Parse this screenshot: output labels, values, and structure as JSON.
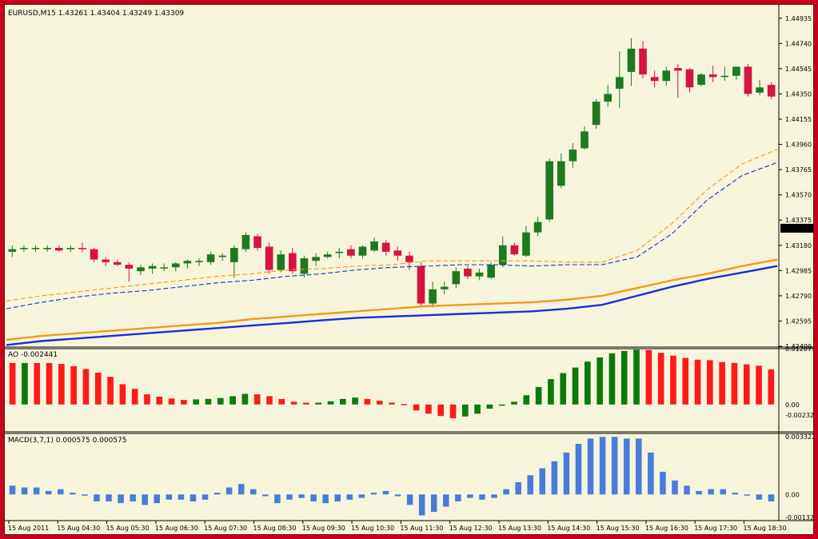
{
  "colors": {
    "background": "#f6f5dc",
    "frame": "#c4001a",
    "bull": "#1f7a1f",
    "bear": "#d8143c",
    "ao_up": "#0b7a0b",
    "ao_down": "#ff1a1a",
    "macd": "#4a7bdc",
    "ma_orange": "#f29a1a",
    "ma_blue": "#1a2fd8"
  },
  "chart_data": [
    {
      "type": "candlestick",
      "title": "EURUSD,M15  1.43261 1.43404 1.43249 1.43309",
      "ylim": [
        1.424,
        1.4502
      ],
      "yticks": [
        "1.44935",
        "1.44740",
        "1.44545",
        "1.44350",
        "1.44155",
        "1.43960",
        "1.43765",
        "1.43570",
        "1.43375",
        "1.43180",
        "1.42985",
        "1.42790",
        "1.42595",
        "1.42400"
      ],
      "current_price": "1.43309",
      "x": [
        "15 Aug 2011",
        "15 Aug 04:30",
        "15 Aug 05:30",
        "15 Aug 06:30",
        "15 Aug 07:30",
        "15 Aug 08:30",
        "15 Aug 09:30",
        "15 Aug 10:30",
        "15 Aug 11:30",
        "15 Aug 12:30",
        "15 Aug 13:30",
        "15 Aug 14:30",
        "15 Aug 15:30",
        "15 Aug 16:30",
        "15 Aug 17:30",
        "15 Aug 18:30"
      ],
      "candles": [
        {
          "o": 1.4313,
          "h": 1.4318,
          "l": 1.4309,
          "c": 1.4315
        },
        {
          "o": 1.4315,
          "h": 1.4318,
          "l": 1.4313,
          "c": 1.4316
        },
        {
          "o": 1.4315,
          "h": 1.4318,
          "l": 1.4313,
          "c": 1.4316
        },
        {
          "o": 1.4315,
          "h": 1.4318,
          "l": 1.4313,
          "c": 1.4316
        },
        {
          "o": 1.4316,
          "h": 1.4318,
          "l": 1.4313,
          "c": 1.4314
        },
        {
          "o": 1.4315,
          "h": 1.4318,
          "l": 1.4313,
          "c": 1.4316
        },
        {
          "o": 1.4316,
          "h": 1.432,
          "l": 1.4313,
          "c": 1.4315
        },
        {
          "o": 1.4315,
          "h": 1.4316,
          "l": 1.4305,
          "c": 1.4307
        },
        {
          "o": 1.4307,
          "h": 1.4309,
          "l": 1.4302,
          "c": 1.4305
        },
        {
          "o": 1.4305,
          "h": 1.4307,
          "l": 1.4302,
          "c": 1.4303
        },
        {
          "o": 1.4303,
          "h": 1.4305,
          "l": 1.429,
          "c": 1.43
        },
        {
          "o": 1.4298,
          "h": 1.4303,
          "l": 1.4295,
          "c": 1.4301
        },
        {
          "o": 1.43,
          "h": 1.4304,
          "l": 1.4296,
          "c": 1.4302
        },
        {
          "o": 1.4301,
          "h": 1.4304,
          "l": 1.4298,
          "c": 1.4301
        },
        {
          "o": 1.4301,
          "h": 1.4305,
          "l": 1.4298,
          "c": 1.4304
        },
        {
          "o": 1.4304,
          "h": 1.4307,
          "l": 1.43,
          "c": 1.4306
        },
        {
          "o": 1.4305,
          "h": 1.4308,
          "l": 1.4302,
          "c": 1.4306
        },
        {
          "o": 1.4305,
          "h": 1.4313,
          "l": 1.4303,
          "c": 1.4311
        },
        {
          "o": 1.4309,
          "h": 1.4312,
          "l": 1.4306,
          "c": 1.431
        },
        {
          "o": 1.4305,
          "h": 1.4318,
          "l": 1.4293,
          "c": 1.4316
        },
        {
          "o": 1.4315,
          "h": 1.4328,
          "l": 1.4313,
          "c": 1.4326
        },
        {
          "o": 1.4325,
          "h": 1.4327,
          "l": 1.4314,
          "c": 1.4316
        },
        {
          "o": 1.4317,
          "h": 1.432,
          "l": 1.4296,
          "c": 1.4299
        },
        {
          "o": 1.4299,
          "h": 1.4314,
          "l": 1.4297,
          "c": 1.4311
        },
        {
          "o": 1.4312,
          "h": 1.4316,
          "l": 1.4296,
          "c": 1.4298
        },
        {
          "o": 1.4296,
          "h": 1.431,
          "l": 1.4293,
          "c": 1.4308
        },
        {
          "o": 1.4306,
          "h": 1.4312,
          "l": 1.4302,
          "c": 1.4309
        },
        {
          "o": 1.4309,
          "h": 1.4313,
          "l": 1.4308,
          "c": 1.4311
        },
        {
          "o": 1.4312,
          "h": 1.4316,
          "l": 1.4308,
          "c": 1.4313
        },
        {
          "o": 1.4315,
          "h": 1.4318,
          "l": 1.4308,
          "c": 1.431
        },
        {
          "o": 1.431,
          "h": 1.4318,
          "l": 1.4308,
          "c": 1.4317
        },
        {
          "o": 1.4314,
          "h": 1.4324,
          "l": 1.4313,
          "c": 1.4321
        },
        {
          "o": 1.432,
          "h": 1.4322,
          "l": 1.431,
          "c": 1.4313
        },
        {
          "o": 1.4314,
          "h": 1.4317,
          "l": 1.4306,
          "c": 1.431
        },
        {
          "o": 1.431,
          "h": 1.4313,
          "l": 1.4299,
          "c": 1.4305
        },
        {
          "o": 1.4302,
          "h": 1.4305,
          "l": 1.427,
          "c": 1.4273
        },
        {
          "o": 1.4273,
          "h": 1.429,
          "l": 1.427,
          "c": 1.4284
        },
        {
          "o": 1.4284,
          "h": 1.429,
          "l": 1.428,
          "c": 1.4286
        },
        {
          "o": 1.4288,
          "h": 1.4301,
          "l": 1.4285,
          "c": 1.4298
        },
        {
          "o": 1.43,
          "h": 1.4302,
          "l": 1.4292,
          "c": 1.4294
        },
        {
          "o": 1.4294,
          "h": 1.43,
          "l": 1.4291,
          "c": 1.4297
        },
        {
          "o": 1.4293,
          "h": 1.4305,
          "l": 1.4292,
          "c": 1.4303
        },
        {
          "o": 1.4303,
          "h": 1.4325,
          "l": 1.4301,
          "c": 1.4318
        },
        {
          "o": 1.4318,
          "h": 1.432,
          "l": 1.431,
          "c": 1.4311
        },
        {
          "o": 1.431,
          "h": 1.4333,
          "l": 1.4309,
          "c": 1.4328
        },
        {
          "o": 1.4328,
          "h": 1.434,
          "l": 1.4325,
          "c": 1.4336
        },
        {
          "o": 1.4338,
          "h": 1.4385,
          "l": 1.4336,
          "c": 1.4383
        },
        {
          "o": 1.4364,
          "h": 1.4389,
          "l": 1.4362,
          "c": 1.4383
        },
        {
          "o": 1.4383,
          "h": 1.4397,
          "l": 1.4378,
          "c": 1.4392
        },
        {
          "o": 1.4393,
          "h": 1.441,
          "l": 1.4392,
          "c": 1.4406
        },
        {
          "o": 1.4411,
          "h": 1.4431,
          "l": 1.4408,
          "c": 1.4429
        },
        {
          "o": 1.4429,
          "h": 1.4442,
          "l": 1.4425,
          "c": 1.4435
        },
        {
          "o": 1.4439,
          "h": 1.4468,
          "l": 1.4424,
          "c": 1.4448
        },
        {
          "o": 1.4452,
          "h": 1.4478,
          "l": 1.4441,
          "c": 1.447
        },
        {
          "o": 1.447,
          "h": 1.4476,
          "l": 1.4447,
          "c": 1.445
        },
        {
          "o": 1.4448,
          "h": 1.4453,
          "l": 1.444,
          "c": 1.4445
        },
        {
          "o": 1.4445,
          "h": 1.4456,
          "l": 1.4441,
          "c": 1.4453
        },
        {
          "o": 1.4455,
          "h": 1.4458,
          "l": 1.4432,
          "c": 1.4453
        },
        {
          "o": 1.4454,
          "h": 1.4455,
          "l": 1.4436,
          "c": 1.444
        },
        {
          "o": 1.4442,
          "h": 1.4451,
          "l": 1.4441,
          "c": 1.445
        },
        {
          "o": 1.445,
          "h": 1.4457,
          "l": 1.4444,
          "c": 1.4448
        },
        {
          "o": 1.4448,
          "h": 1.4456,
          "l": 1.4445,
          "c": 1.4449
        },
        {
          "o": 1.4449,
          "h": 1.4455,
          "l": 1.4446,
          "c": 1.4456
        },
        {
          "o": 1.4456,
          "h": 1.4458,
          "l": 1.4433,
          "c": 1.4435
        },
        {
          "o": 1.4436,
          "h": 1.4446,
          "l": 1.4434,
          "c": 1.444
        },
        {
          "o": 1.4442,
          "h": 1.4444,
          "l": 1.4431,
          "c": 1.4433
        }
      ],
      "moving_averages": [
        {
          "style": "dashed",
          "color": "ma_orange",
          "values": [
            1.4275,
            1.4279,
            1.4282,
            1.4285,
            1.4288,
            1.4291,
            1.4294,
            1.4296,
            1.4299,
            1.43,
            1.4302,
            1.4303,
            1.4306,
            1.4306,
            1.4306,
            1.4306,
            1.4305,
            1.4305,
            1.4314,
            1.4335,
            1.4361,
            1.4381,
            1.4392
          ]
        },
        {
          "style": "dashed",
          "color": "ma_blue",
          "values": [
            1.4269,
            1.4274,
            1.4278,
            1.4281,
            1.4283,
            1.4286,
            1.4289,
            1.4291,
            1.4294,
            1.4296,
            1.4299,
            1.4301,
            1.4302,
            1.4303,
            1.4303,
            1.4302,
            1.4303,
            1.4303,
            1.4309,
            1.4327,
            1.4353,
            1.4372,
            1.4382
          ]
        },
        {
          "style": "solid",
          "color": "ma_orange",
          "values": [
            1.4245,
            1.4248,
            1.425,
            1.4252,
            1.4254,
            1.4256,
            1.4258,
            1.4261,
            1.4263,
            1.4265,
            1.4267,
            1.4269,
            1.4271,
            1.4272,
            1.4273,
            1.4274,
            1.4276,
            1.4279,
            1.4285,
            1.4291,
            1.4296,
            1.4302,
            1.4307
          ]
        },
        {
          "style": "solid",
          "color": "ma_blue",
          "values": [
            1.4241,
            1.4244,
            1.4246,
            1.4248,
            1.425,
            1.4252,
            1.4254,
            1.4256,
            1.4258,
            1.426,
            1.4262,
            1.4263,
            1.4264,
            1.4265,
            1.4266,
            1.4267,
            1.4269,
            1.4272,
            1.4279,
            1.4286,
            1.4292,
            1.4297,
            1.4302
          ]
        }
      ]
    },
    {
      "type": "bar",
      "title": "AO -0.002441",
      "ylim": [
        -0.0035,
        0.0121
      ],
      "yticks": [
        "0.012079",
        "0.00",
        "-0.00232"
      ],
      "bars": [
        {
          "v": 0.009,
          "d": 0
        },
        {
          "v": 0.009,
          "d": 1
        },
        {
          "v": 0.009,
          "d": 0
        },
        {
          "v": 0.009,
          "d": 0
        },
        {
          "v": 0.0088,
          "d": 0
        },
        {
          "v": 0.0083,
          "d": 0
        },
        {
          "v": 0.0077,
          "d": 0
        },
        {
          "v": 0.0069,
          "d": 0
        },
        {
          "v": 0.006,
          "d": 0
        },
        {
          "v": 0.0044,
          "d": 0
        },
        {
          "v": 0.0034,
          "d": 0
        },
        {
          "v": 0.0022,
          "d": 0
        },
        {
          "v": 0.0017,
          "d": 0
        },
        {
          "v": 0.0013,
          "d": 0
        },
        {
          "v": 0.001,
          "d": 0
        },
        {
          "v": 0.0011,
          "d": 1
        },
        {
          "v": 0.0012,
          "d": 1
        },
        {
          "v": 0.0014,
          "d": 1
        },
        {
          "v": 0.0018,
          "d": 1
        },
        {
          "v": 0.0023,
          "d": 1
        },
        {
          "v": 0.0022,
          "d": 0
        },
        {
          "v": 0.0018,
          "d": 0
        },
        {
          "v": 0.0012,
          "d": 0
        },
        {
          "v": 0.0006,
          "d": 0
        },
        {
          "v": 0.0004,
          "d": 0
        },
        {
          "v": 0.0004,
          "d": 1
        },
        {
          "v": 0.0007,
          "d": 1
        },
        {
          "v": 0.0012,
          "d": 1
        },
        {
          "v": 0.0015,
          "d": 1
        },
        {
          "v": 0.0012,
          "d": 0
        },
        {
          "v": 0.0008,
          "d": 0
        },
        {
          "v": 0.0004,
          "d": 0
        },
        {
          "v": 0.0001,
          "d": 0
        },
        {
          "v": -0.0013,
          "d": 0
        },
        {
          "v": -0.002,
          "d": 0
        },
        {
          "v": -0.0025,
          "d": 0
        },
        {
          "v": -0.003,
          "d": 0
        },
        {
          "v": -0.0026,
          "d": 1
        },
        {
          "v": -0.002,
          "d": 1
        },
        {
          "v": -0.0009,
          "d": 1
        },
        {
          "v": -0.0002,
          "d": 1
        },
        {
          "v": 0.0006,
          "d": 1
        },
        {
          "v": 0.002,
          "d": 1
        },
        {
          "v": 0.0038,
          "d": 1
        },
        {
          "v": 0.0055,
          "d": 1
        },
        {
          "v": 0.0068,
          "d": 1
        },
        {
          "v": 0.008,
          "d": 1
        },
        {
          "v": 0.0093,
          "d": 1
        },
        {
          "v": 0.0102,
          "d": 1
        },
        {
          "v": 0.0111,
          "d": 1
        },
        {
          "v": 0.0116,
          "d": 1
        },
        {
          "v": 0.0119,
          "d": 1
        },
        {
          "v": 0.0118,
          "d": 0
        },
        {
          "v": 0.0112,
          "d": 0
        },
        {
          "v": 0.0106,
          "d": 0
        },
        {
          "v": 0.0101,
          "d": 0
        },
        {
          "v": 0.0097,
          "d": 0
        },
        {
          "v": 0.0096,
          "d": 0
        },
        {
          "v": 0.0092,
          "d": 0
        },
        {
          "v": 0.009,
          "d": 0
        },
        {
          "v": 0.0087,
          "d": 0
        },
        {
          "v": 0.0084,
          "d": 0
        },
        {
          "v": 0.0076,
          "d": 0
        }
      ]
    },
    {
      "type": "bar",
      "title": "MACD(3,7,1) 0.000575 0.000575",
      "ylim": [
        -0.0015,
        0.00345
      ],
      "yticks": [
        "0.003322",
        "0.00",
        "-0.00132"
      ],
      "values": [
        0.0005,
        0.0004,
        0.0004,
        0.0002,
        0.0003,
        0.0001,
        0.0,
        -0.0004,
        -0.0004,
        -0.0005,
        -0.0004,
        -0.0006,
        -0.0005,
        -0.0003,
        -0.0003,
        -0.0004,
        -0.0003,
        0.0001,
        0.0004,
        0.0006,
        0.0003,
        -0.0001,
        -0.0005,
        -0.0003,
        -0.0002,
        -0.0004,
        -0.0005,
        -0.0004,
        -0.0003,
        -0.0002,
        0.0001,
        0.0002,
        -0.0001,
        -0.0006,
        -0.0012,
        -0.001,
        -0.0007,
        -0.0004,
        -0.0002,
        -0.0003,
        -0.0002,
        0.0003,
        0.0007,
        0.0011,
        0.0015,
        0.0019,
        0.0024,
        0.0029,
        0.0032,
        0.0033,
        0.0033,
        0.0032,
        0.0032,
        0.0024,
        0.0013,
        0.0008,
        0.0005,
        0.0002,
        0.0003,
        0.0003,
        0.0001,
        0.0,
        -0.0003,
        -0.0004
      ]
    }
  ]
}
